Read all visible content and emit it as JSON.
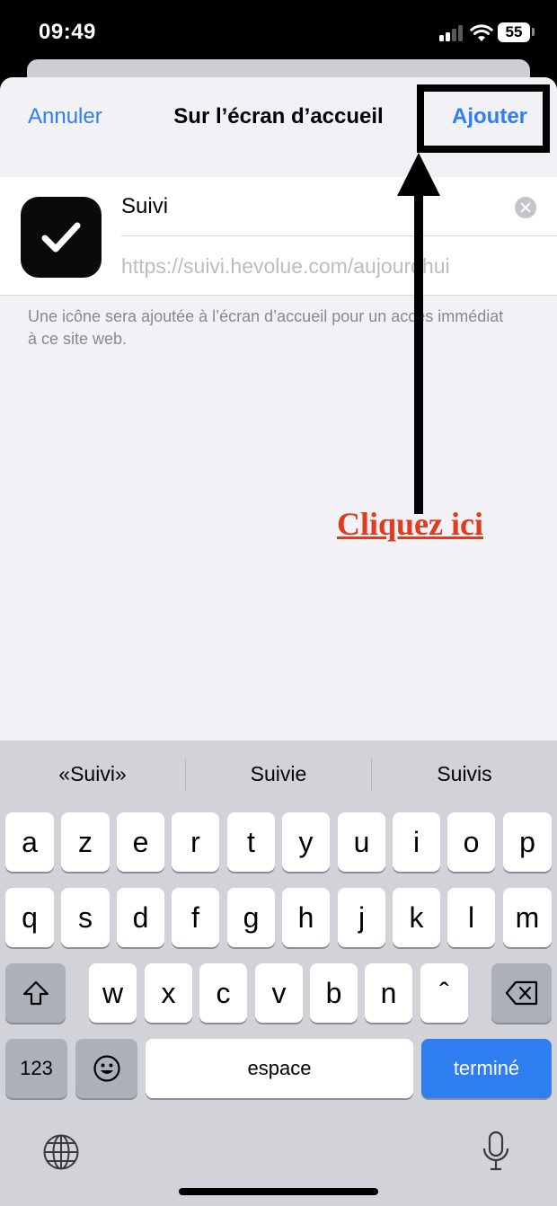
{
  "status_bar": {
    "time": "09:49",
    "battery": "55"
  },
  "nav": {
    "cancel_label": "Annuler",
    "title": "Sur l’écran d’accueil",
    "add_label": "Ajouter"
  },
  "form": {
    "name_value": "Suivi",
    "url": "https://suivi.hevolue.com/aujourdhui"
  },
  "footnote": "Une icône sera ajoutée à l’écran d’accueil pour un accès immédiat à ce site web.",
  "annotation": {
    "text": "Cliquez ici",
    "color": "#e23a1f"
  },
  "keyboard": {
    "suggestions": [
      "«Suivi»",
      "Suivie",
      "Suivis"
    ],
    "row1": [
      "a",
      "z",
      "e",
      "r",
      "t",
      "y",
      "u",
      "i",
      "o",
      "p"
    ],
    "row2": [
      "q",
      "s",
      "d",
      "f",
      "g",
      "h",
      "j",
      "k",
      "l",
      "m"
    ],
    "row3": [
      "w",
      "x",
      "c",
      "v",
      "b",
      "n",
      "ˆ"
    ],
    "numbers_label": "123",
    "space_label": "espace",
    "done_label": "terminé"
  },
  "colors": {
    "accent": "#2f7ef0",
    "sheet_bg": "#f1f1f6",
    "keyboard_bg": "#d1d3d9"
  }
}
